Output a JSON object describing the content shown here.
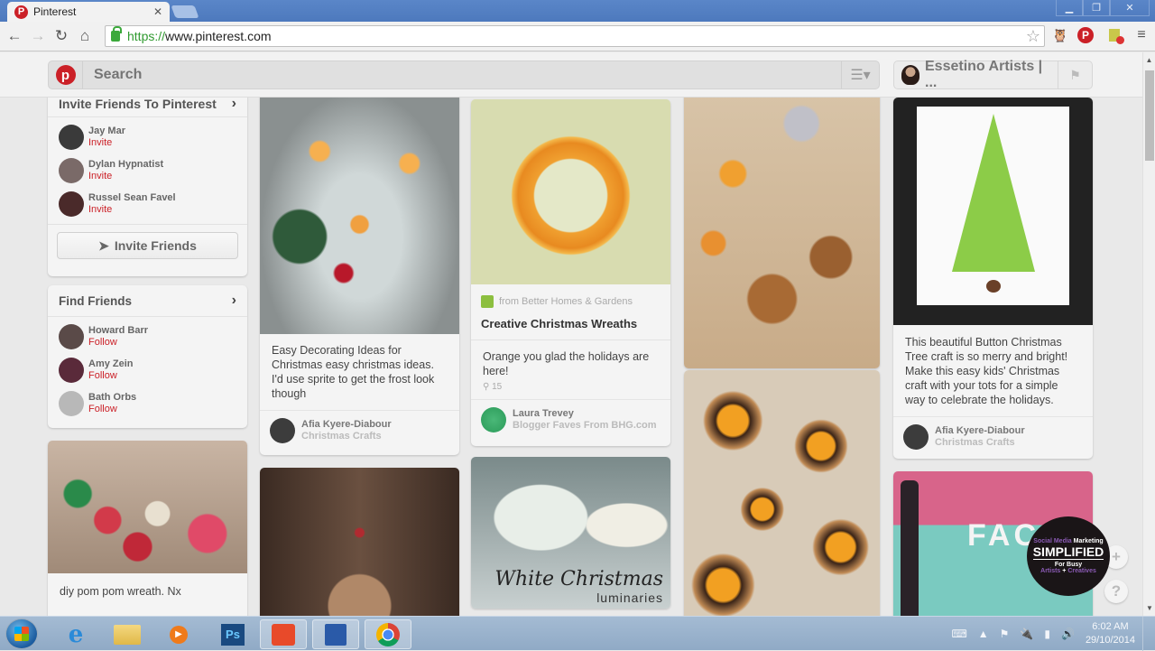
{
  "browser": {
    "tab_title": "Pinterest",
    "url_scheme": "https://",
    "url_rest": "www.pinterest.com",
    "window_buttons": [
      "minimize",
      "restore",
      "close"
    ],
    "extensions": [
      "hootsuite-owl-icon",
      "pinterest-pin-it-icon",
      "blocked-extension-icon",
      "chrome-menu-icon"
    ]
  },
  "header": {
    "logo": "p",
    "search_placeholder": "Search",
    "user_name": "Essetino Artists | ..."
  },
  "sidebar": {
    "invite": {
      "title": "Invite Friends To Pinterest",
      "friends": [
        {
          "name": "Jay Mar",
          "action": "Invite",
          "color": "#3a3a3a"
        },
        {
          "name": "Dylan Hypnatist",
          "action": "Invite",
          "color": "#7a6a68"
        },
        {
          "name": "Russel Sean Favel",
          "action": "Invite",
          "color": "#4a2a2a"
        }
      ],
      "button_label": "Invite Friends"
    },
    "find": {
      "title": "Find Friends",
      "friends": [
        {
          "name": "Howard Barr",
          "action": "Follow",
          "color": "#5a4a48"
        },
        {
          "name": "Amy Zein",
          "action": "Follow",
          "color": "#5a2a3a"
        },
        {
          "name": "Bath Orbs",
          "action": "Follow",
          "color": "#b8b8b8"
        }
      ]
    },
    "pom_pin": {
      "description": "diy pom pom wreath. Nx"
    }
  },
  "pins": {
    "candles": {
      "description": "Easy Decorating Ideas for Christmas easy christmas ideas. I'd use sprite to get the frost look though",
      "pinner": "Afia Kyere-Diabour",
      "board": "Christmas Crafts"
    },
    "wreath": {
      "source": "from Better Homes & Gardens",
      "title": "Creative Christmas Wreaths",
      "description": "Orange you glad the holidays are here!",
      "repins": "15",
      "pinner": "Laura Trevey",
      "board": "Blogger Faves From BHG.com"
    },
    "luminaries": {
      "overlay_title": "White Christmas",
      "overlay_sub": "luminaries"
    },
    "button_tree": {
      "description": "This beautiful Button Christmas Tree craft is so merry and bright! Make this easy kids' Christmas craft with your tots for a simple way to celebrate the holidays.",
      "pinner": "Afia Kyere-Diabour",
      "board": "Christmas Crafts"
    },
    "face_sign": {
      "text": "FAC"
    }
  },
  "overlay_badge": {
    "line1a": "Social Media",
    "line1b": "Marketing",
    "line2": "SIMPLIFIED",
    "line3": "For Busy",
    "line4a": "Artists",
    "line4b": "+",
    "line4c": "Creatives"
  },
  "float_buttons": {
    "add": "+",
    "help": "?"
  },
  "taskbar": {
    "apps": [
      "start",
      "internet-explorer",
      "file-explorer",
      "media-player",
      "photoshop",
      "powerpoint",
      "word",
      "chrome"
    ],
    "ps_label": "Ps",
    "time": "6:02 AM",
    "date": "29/10/2014"
  }
}
